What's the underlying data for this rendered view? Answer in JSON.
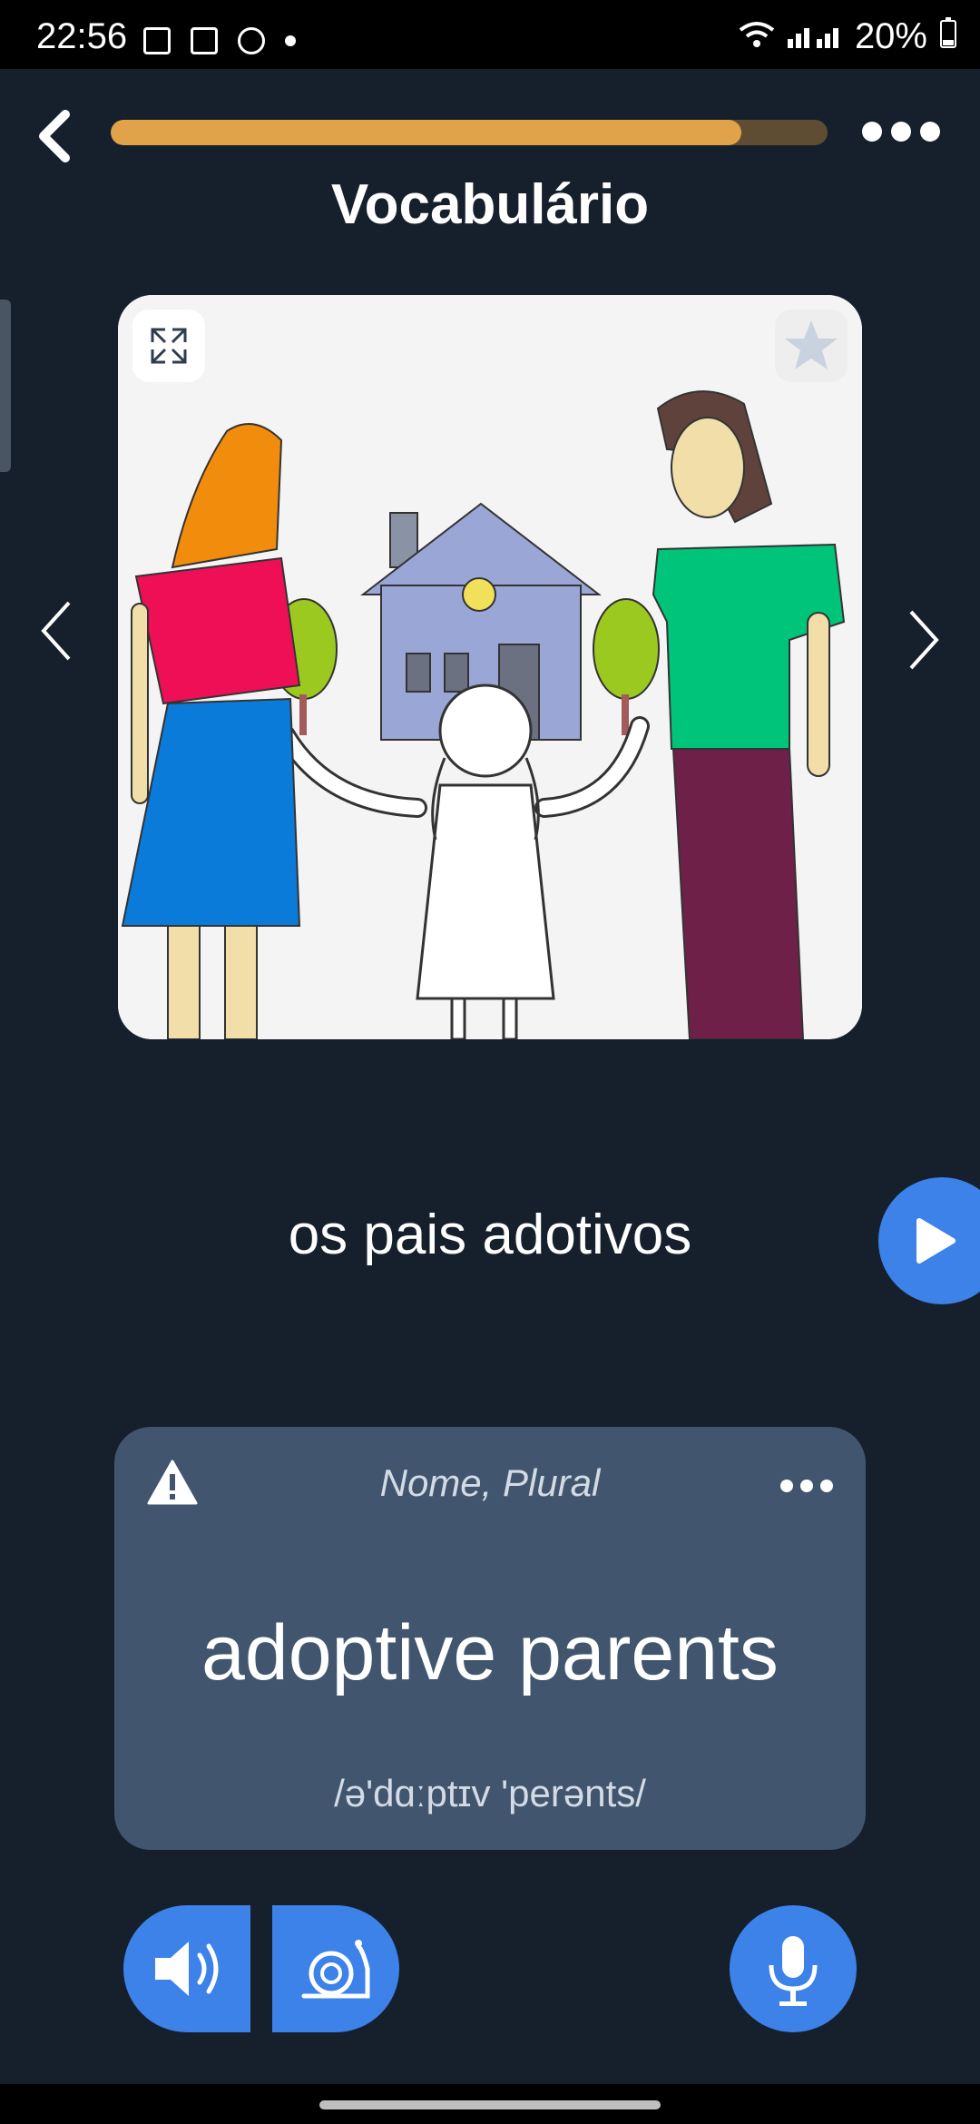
{
  "status_bar": {
    "time": "22:56",
    "battery": "20%"
  },
  "header": {
    "title": "Vocabulário",
    "progress_fraction": 0.88
  },
  "card": {
    "word": "os pais adotivos"
  },
  "translation": {
    "part_of_speech": "Nome, Plural",
    "text": "adoptive parents",
    "phonetic": "/ə'dɑːptɪv 'perənts/"
  },
  "colors": {
    "background": "#16202d",
    "accent": "#3c82e8",
    "progress": "#e0a34a",
    "card": "#41566e"
  },
  "icons": [
    "back-icon",
    "more-icon",
    "expand-icon",
    "star-icon",
    "chevron-left-icon",
    "chevron-right-icon",
    "play-icon",
    "warning-icon",
    "speaker-icon",
    "snail-icon",
    "mic-icon"
  ]
}
